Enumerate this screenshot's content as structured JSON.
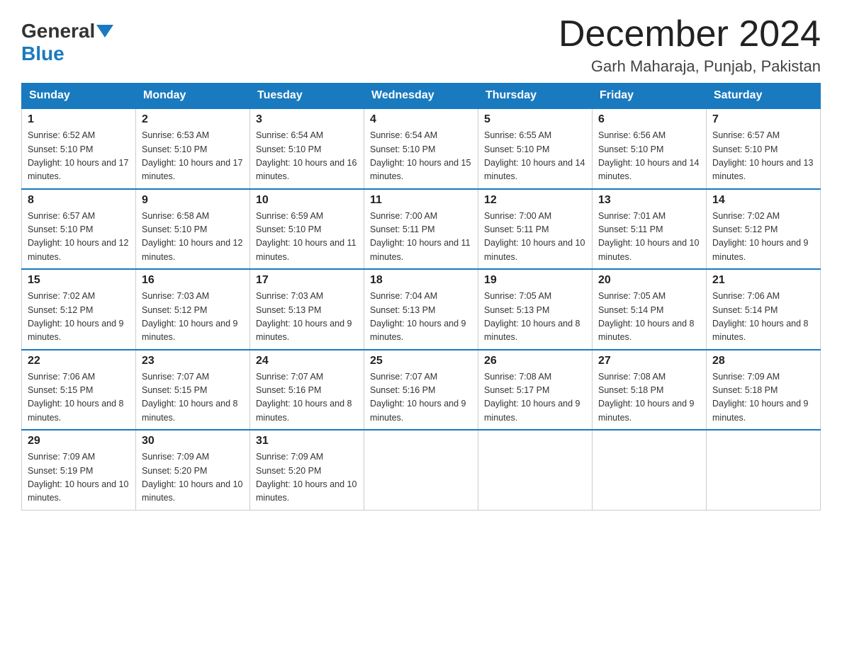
{
  "header": {
    "logo_general": "General",
    "logo_blue": "Blue",
    "month_title": "December 2024",
    "location": "Garh Maharaja, Punjab, Pakistan"
  },
  "weekdays": [
    "Sunday",
    "Monday",
    "Tuesday",
    "Wednesday",
    "Thursday",
    "Friday",
    "Saturday"
  ],
  "weeks": [
    [
      {
        "day": "1",
        "sunrise": "6:52 AM",
        "sunset": "5:10 PM",
        "daylight": "10 hours and 17 minutes."
      },
      {
        "day": "2",
        "sunrise": "6:53 AM",
        "sunset": "5:10 PM",
        "daylight": "10 hours and 17 minutes."
      },
      {
        "day": "3",
        "sunrise": "6:54 AM",
        "sunset": "5:10 PM",
        "daylight": "10 hours and 16 minutes."
      },
      {
        "day": "4",
        "sunrise": "6:54 AM",
        "sunset": "5:10 PM",
        "daylight": "10 hours and 15 minutes."
      },
      {
        "day": "5",
        "sunrise": "6:55 AM",
        "sunset": "5:10 PM",
        "daylight": "10 hours and 14 minutes."
      },
      {
        "day": "6",
        "sunrise": "6:56 AM",
        "sunset": "5:10 PM",
        "daylight": "10 hours and 14 minutes."
      },
      {
        "day": "7",
        "sunrise": "6:57 AM",
        "sunset": "5:10 PM",
        "daylight": "10 hours and 13 minutes."
      }
    ],
    [
      {
        "day": "8",
        "sunrise": "6:57 AM",
        "sunset": "5:10 PM",
        "daylight": "10 hours and 12 minutes."
      },
      {
        "day": "9",
        "sunrise": "6:58 AM",
        "sunset": "5:10 PM",
        "daylight": "10 hours and 12 minutes."
      },
      {
        "day": "10",
        "sunrise": "6:59 AM",
        "sunset": "5:10 PM",
        "daylight": "10 hours and 11 minutes."
      },
      {
        "day": "11",
        "sunrise": "7:00 AM",
        "sunset": "5:11 PM",
        "daylight": "10 hours and 11 minutes."
      },
      {
        "day": "12",
        "sunrise": "7:00 AM",
        "sunset": "5:11 PM",
        "daylight": "10 hours and 10 minutes."
      },
      {
        "day": "13",
        "sunrise": "7:01 AM",
        "sunset": "5:11 PM",
        "daylight": "10 hours and 10 minutes."
      },
      {
        "day": "14",
        "sunrise": "7:02 AM",
        "sunset": "5:12 PM",
        "daylight": "10 hours and 9 minutes."
      }
    ],
    [
      {
        "day": "15",
        "sunrise": "7:02 AM",
        "sunset": "5:12 PM",
        "daylight": "10 hours and 9 minutes."
      },
      {
        "day": "16",
        "sunrise": "7:03 AM",
        "sunset": "5:12 PM",
        "daylight": "10 hours and 9 minutes."
      },
      {
        "day": "17",
        "sunrise": "7:03 AM",
        "sunset": "5:13 PM",
        "daylight": "10 hours and 9 minutes."
      },
      {
        "day": "18",
        "sunrise": "7:04 AM",
        "sunset": "5:13 PM",
        "daylight": "10 hours and 9 minutes."
      },
      {
        "day": "19",
        "sunrise": "7:05 AM",
        "sunset": "5:13 PM",
        "daylight": "10 hours and 8 minutes."
      },
      {
        "day": "20",
        "sunrise": "7:05 AM",
        "sunset": "5:14 PM",
        "daylight": "10 hours and 8 minutes."
      },
      {
        "day": "21",
        "sunrise": "7:06 AM",
        "sunset": "5:14 PM",
        "daylight": "10 hours and 8 minutes."
      }
    ],
    [
      {
        "day": "22",
        "sunrise": "7:06 AM",
        "sunset": "5:15 PM",
        "daylight": "10 hours and 8 minutes."
      },
      {
        "day": "23",
        "sunrise": "7:07 AM",
        "sunset": "5:15 PM",
        "daylight": "10 hours and 8 minutes."
      },
      {
        "day": "24",
        "sunrise": "7:07 AM",
        "sunset": "5:16 PM",
        "daylight": "10 hours and 8 minutes."
      },
      {
        "day": "25",
        "sunrise": "7:07 AM",
        "sunset": "5:16 PM",
        "daylight": "10 hours and 9 minutes."
      },
      {
        "day": "26",
        "sunrise": "7:08 AM",
        "sunset": "5:17 PM",
        "daylight": "10 hours and 9 minutes."
      },
      {
        "day": "27",
        "sunrise": "7:08 AM",
        "sunset": "5:18 PM",
        "daylight": "10 hours and 9 minutes."
      },
      {
        "day": "28",
        "sunrise": "7:09 AM",
        "sunset": "5:18 PM",
        "daylight": "10 hours and 9 minutes."
      }
    ],
    [
      {
        "day": "29",
        "sunrise": "7:09 AM",
        "sunset": "5:19 PM",
        "daylight": "10 hours and 10 minutes."
      },
      {
        "day": "30",
        "sunrise": "7:09 AM",
        "sunset": "5:20 PM",
        "daylight": "10 hours and 10 minutes."
      },
      {
        "day": "31",
        "sunrise": "7:09 AM",
        "sunset": "5:20 PM",
        "daylight": "10 hours and 10 minutes."
      },
      null,
      null,
      null,
      null
    ]
  ]
}
